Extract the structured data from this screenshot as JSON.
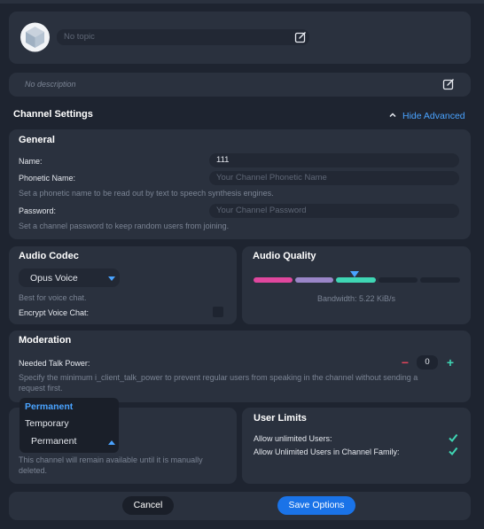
{
  "header": {
    "topic_value": "No topic",
    "description_value": "No description"
  },
  "section": {
    "title": "Channel Settings",
    "toggle_label": "Hide Advanced"
  },
  "general": {
    "title": "General",
    "name_label": "Name:",
    "name_value": "111",
    "phonetic_label": "Phonetic Name:",
    "phonetic_placeholder": "Your Channel Phonetic Name",
    "phonetic_hint": "Set a phonetic name to be read out by text to speech synthesis engines.",
    "password_label": "Password:",
    "password_placeholder": "Your Channel Password",
    "password_hint": "Set a channel password to keep random users from joining."
  },
  "audio_codec": {
    "title": "Audio Codec",
    "selected": "Opus Voice",
    "hint": "Best for voice chat.",
    "encrypt_label": "Encrypt Voice Chat:"
  },
  "audio_quality": {
    "title": "Audio Quality",
    "bandwidth": "Bandwidth: 5.22 KiB/s",
    "level": 0.6,
    "colors": [
      "#e0479e",
      "#9a86c8",
      "#3fd6b4"
    ]
  },
  "moderation": {
    "title": "Moderation",
    "talk_power_label": "Needed Talk Power:",
    "talk_power_value": "0",
    "hint": "Specify the minimum i_client_talk_power to prevent regular users from speaking in the channel without sending a request first."
  },
  "channel_type": {
    "dropdown_options": [
      "Permanent",
      "Temporary"
    ],
    "highlighted_option": "Permanent",
    "selected": "Permanent",
    "hint": "This channel will remain available until it is manually deleted."
  },
  "user_limits": {
    "title": "User Limits",
    "unlimited_label": "Allow unlimited Users:",
    "family_label": "Allow Unlimited Users in Channel Family:"
  },
  "footer": {
    "cancel_label": "Cancel",
    "save_label": "Save Options"
  },
  "colors": {
    "accent": "#1a73e8",
    "link": "#4aa3ff",
    "check": "#3fd6b4",
    "minus": "#e0445a",
    "plus": "#3fd6b4"
  }
}
